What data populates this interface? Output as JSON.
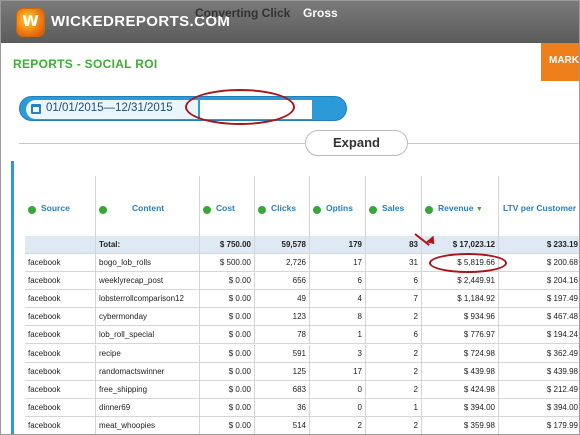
{
  "app": {
    "brand": "WICKEDREPORTS.COM",
    "logo_letter": "W"
  },
  "page": {
    "title": "REPORTS - SOCIAL ROI",
    "right_tab": "MARK"
  },
  "filters": {
    "date_range": "01/01/2015—12/31/2015",
    "attribution": "Converting Click",
    "metric": "Gross"
  },
  "expand_label": "Expand",
  "table": {
    "columns": [
      "Source",
      "Content",
      "Cost",
      "Clicks",
      "Optins",
      "Sales",
      "Revenue",
      "LTV per Customer"
    ],
    "sorted_column": "Revenue",
    "total": {
      "label": "Total:",
      "cost": "$ 750.00",
      "clicks": "59,578",
      "optins": "179",
      "sales": "83",
      "revenue": "$ 17,023.12",
      "ltv": "$ 233.19"
    },
    "rows": [
      {
        "source": "facebook",
        "content": "bogo_lob_rolls",
        "cost": "$ 500.00",
        "clicks": "2,726",
        "optins": "17",
        "sales": "31",
        "revenue": "$ 5,819.66",
        "ltv": "$ 200.68"
      },
      {
        "source": "facebook",
        "content": "weeklyrecap_post",
        "cost": "$ 0.00",
        "clicks": "656",
        "optins": "6",
        "sales": "6",
        "revenue": "$ 2,449.91",
        "ltv": "$ 204.16"
      },
      {
        "source": "facebook",
        "content": "lobsterrollcomparison12",
        "cost": "$ 0.00",
        "clicks": "49",
        "optins": "4",
        "sales": "7",
        "revenue": "$ 1,184.92",
        "ltv": "$ 197.49"
      },
      {
        "source": "facebook",
        "content": "cybermonday",
        "cost": "$ 0.00",
        "clicks": "123",
        "optins": "8",
        "sales": "2",
        "revenue": "$ 934.96",
        "ltv": "$ 467.48"
      },
      {
        "source": "facebook",
        "content": "lob_roll_special",
        "cost": "$ 0.00",
        "clicks": "78",
        "optins": "1",
        "sales": "6",
        "revenue": "$ 776.97",
        "ltv": "$ 194.24"
      },
      {
        "source": "facebook",
        "content": "recipe",
        "cost": "$ 0.00",
        "clicks": "591",
        "optins": "3",
        "sales": "2",
        "revenue": "$ 724.98",
        "ltv": "$ 362.49"
      },
      {
        "source": "facebook",
        "content": "randomactswinner",
        "cost": "$ 0.00",
        "clicks": "125",
        "optins": "17",
        "sales": "2",
        "revenue": "$ 439.98",
        "ltv": "$ 439.98"
      },
      {
        "source": "facebook",
        "content": "free_shipping",
        "cost": "$ 0.00",
        "clicks": "683",
        "optins": "0",
        "sales": "2",
        "revenue": "$ 424.98",
        "ltv": "$ 212.49"
      },
      {
        "source": "facebook",
        "content": "dinner69",
        "cost": "$ 0.00",
        "clicks": "36",
        "optins": "0",
        "sales": "1",
        "revenue": "$ 394.00",
        "ltv": "$ 394.00"
      },
      {
        "source": "facebook",
        "content": "meat_whoopies",
        "cost": "$ 0.00",
        "clicks": "514",
        "optins": "2",
        "sales": "2",
        "revenue": "$ 359.98",
        "ltv": "$ 179.99"
      }
    ]
  },
  "colors": {
    "accent_green": "#3bb033",
    "pill_blue": "#2c9ad8",
    "annotation_red": "#a8151b",
    "orange_tab": "#ef7f1a"
  },
  "icons": [
    "flame-logo-icon",
    "calendar-icon",
    "info-circle-icon",
    "sort-desc-icon"
  ]
}
